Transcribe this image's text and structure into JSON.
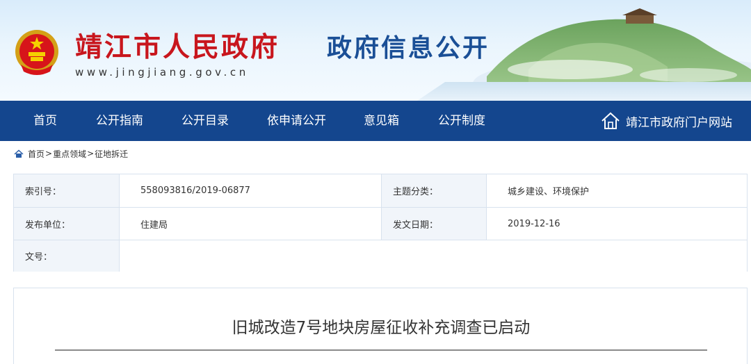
{
  "header": {
    "site_title": "靖江市人民政府",
    "site_url": "www.jingjiang.gov.cn",
    "section_title": "政府信息公开"
  },
  "nav": {
    "items": [
      {
        "label": "首页"
      },
      {
        "label": "公开指南"
      },
      {
        "label": "公开目录"
      },
      {
        "label": "依申请公开"
      },
      {
        "label": "意见箱"
      },
      {
        "label": "公开制度"
      }
    ],
    "portal_link": "靖江市政府门户网站"
  },
  "breadcrumb": {
    "items": [
      "首页",
      "重点领域",
      "征地拆迁"
    ],
    "separator": ">"
  },
  "info": {
    "index_label": "索引号：",
    "index_value": "558093816/2019-06877",
    "topic_label": "主题分类：",
    "topic_value": "城乡建设、环境保护",
    "publisher_label": "发布单位：",
    "publisher_value": "住建局",
    "date_label": "发文日期：",
    "date_value": "2019-12-16",
    "docno_label": "文号：",
    "docno_value": ""
  },
  "article": {
    "title": "旧城改造7号地块房屋征收补充调查已启动"
  },
  "colors": {
    "nav_bg": "#14468e",
    "title_red": "#c8161d",
    "section_blue": "#1a4f96",
    "label_bg": "#f1f5fa",
    "border": "#d8e2ee"
  }
}
